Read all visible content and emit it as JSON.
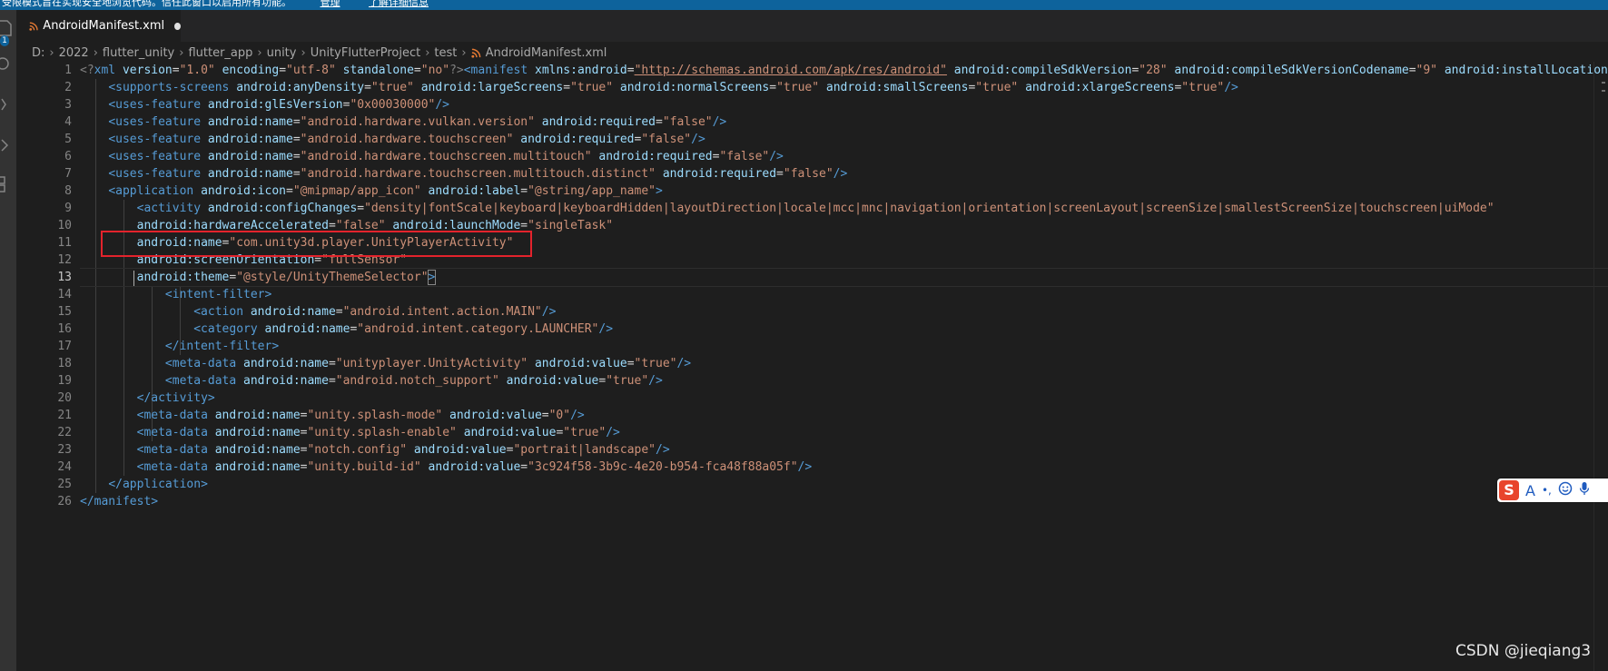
{
  "banner": {
    "text": "受限模式旨在实现安全地浏览代码。信任此窗口以启用所有功能。",
    "manage_link": "管理",
    "learn_more_link": "了解详细信息"
  },
  "activity_bar": {
    "badge_count": "1"
  },
  "tab": {
    "file_name": "AndroidManifest.xml",
    "modified": true
  },
  "breadcrumb": {
    "parts": [
      "D:",
      "2022",
      "flutter_unity",
      "flutter_app",
      "unity",
      "UnityFlutterProject",
      "test",
      "AndroidManifest.xml"
    ]
  },
  "editor": {
    "line_numbers": [
      "1",
      "2",
      "3",
      "4",
      "5",
      "6",
      "7",
      "8",
      "9",
      "10",
      "11",
      "12",
      "13",
      "14",
      "15",
      "16",
      "17",
      "18",
      "19",
      "20",
      "21",
      "22",
      "23",
      "24",
      "25",
      "26"
    ],
    "current_line": 13,
    "lines": {
      "l1": {
        "pi_open": "<?",
        "pi_name": "xml",
        "attr1": "version",
        "val1": "\"1.0\"",
        "attr2": "encoding",
        "val2": "\"utf-8\"",
        "attr3": "standalone",
        "val3": "\"no\"",
        "pi_close": "?>",
        "tag_open": "<manifest",
        "attr4": "xmlns:android",
        "val4": "\"http://schemas.android.com/apk/res/android\"",
        "attr5": "android:compileSdkVersion",
        "val5": "\"28\"",
        "attr6": "android:compileSdkVersionCodename",
        "val6": "\"9\"",
        "attr7": "android:installLocation",
        "val7": "\""
      },
      "l2": {
        "tag": "<supports-screens",
        "a1": "android:anyDensity",
        "v1": "\"true\"",
        "a2": "android:largeScreens",
        "v2": "\"true\"",
        "a3": "android:normalScreens",
        "v3": "\"true\"",
        "a4": "android:smallScreens",
        "v4": "\"true\"",
        "a5": "android:xlargeScreens",
        "v5": "\"true\"",
        "end": "/>"
      },
      "l3": {
        "tag": "<uses-feature",
        "a1": "android:glEsVersion",
        "v1": "\"0x00030000\"",
        "end": "/>"
      },
      "l4": {
        "tag": "<uses-feature",
        "a1": "android:name",
        "v1": "\"android.hardware.vulkan.version\"",
        "a2": "android:required",
        "v2": "\"false\"",
        "end": "/>"
      },
      "l5": {
        "tag": "<uses-feature",
        "a1": "android:name",
        "v1": "\"android.hardware.touchscreen\"",
        "a2": "android:required",
        "v2": "\"false\"",
        "end": "/>"
      },
      "l6": {
        "tag": "<uses-feature",
        "a1": "android:name",
        "v1": "\"android.hardware.touchscreen.multitouch\"",
        "a2": "android:required",
        "v2": "\"false\"",
        "end": "/>"
      },
      "l7": {
        "tag": "<uses-feature",
        "a1": "android:name",
        "v1": "\"android.hardware.touchscreen.multitouch.distinct\"",
        "a2": "android:required",
        "v2": "\"false\"",
        "end": "/>"
      },
      "l8": {
        "tag": "<application",
        "a1": "android:icon",
        "v1": "\"@mipmap/app_icon\"",
        "a2": "android:label",
        "v2": "\"@string/app_name\"",
        "end": ">"
      },
      "l9": {
        "tag": "<activity",
        "a1": "android:configChanges",
        "v1": "\"density|fontScale|keyboard|keyboardHidden|layoutDirection|locale|mcc|mnc|navigation|orientation|screenLayout|screenSize|smallestScreenSize|touchscreen|uiMode\""
      },
      "l10": {
        "a1": "android:hardwareAccelerated",
        "v1": "\"false\"",
        "a2": "android:launchMode",
        "v2": "\"singleTask\""
      },
      "l11": {
        "a1": "android:name",
        "v1": "\"com.unity3d.player.UnityPlayerActivity\""
      },
      "l12": {
        "a1": "android:screenOrientation",
        "v1": "\"fullSensor\""
      },
      "l13": {
        "a1": "android:theme",
        "v1": "\"@style/UnityThemeSelector\"",
        "end": ">"
      },
      "l14": {
        "tag": "<intent-filter",
        "end": ">"
      },
      "l15": {
        "tag": "<action",
        "a1": "android:name",
        "v1": "\"android.intent.action.MAIN\"",
        "end": "/>"
      },
      "l16": {
        "tag": "<category",
        "a1": "android:name",
        "v1": "\"android.intent.category.LAUNCHER\"",
        "end": "/>"
      },
      "l17": {
        "tag": "</intent-filter",
        "end": ">"
      },
      "l18": {
        "tag": "<meta-data",
        "a1": "android:name",
        "v1": "\"unityplayer.UnityActivity\"",
        "a2": "android:value",
        "v2": "\"true\"",
        "end": "/>"
      },
      "l19": {
        "tag": "<meta-data",
        "a1": "android:name",
        "v1": "\"android.notch_support\"",
        "a2": "android:value",
        "v2": "\"true\"",
        "end": "/>"
      },
      "l20": {
        "tag": "</activity",
        "end": ">"
      },
      "l21": {
        "tag": "<meta-data",
        "a1": "android:name",
        "v1": "\"unity.splash-mode\"",
        "a2": "android:value",
        "v2": "\"0\"",
        "end": "/>"
      },
      "l22": {
        "tag": "<meta-data",
        "a1": "android:name",
        "v1": "\"unity.splash-enable\"",
        "a2": "android:value",
        "v2": "\"true\"",
        "end": "/>"
      },
      "l23": {
        "tag": "<meta-data",
        "a1": "android:name",
        "v1": "\"notch.config\"",
        "a2": "android:value",
        "v2": "\"portrait|landscape\"",
        "end": "/>"
      },
      "l24": {
        "tag": "<meta-data",
        "a1": "android:name",
        "v1": "\"unity.build-id\"",
        "a2": "android:value",
        "v2": "\"3c924f58-3b9c-4e20-b954-fca48f88a05f\"",
        "end": "/>"
      },
      "l25": {
        "tag": "</application",
        "end": ">"
      },
      "l26": {
        "tag": "</manifest",
        "end": ">"
      }
    }
  },
  "ime_toolbar": {
    "logo": "S",
    "mode": "A",
    "punct": "•,"
  },
  "watermark": "CSDN @jieqiang3",
  "colors": {
    "tag": "#569cd6",
    "attribute": "#9cdcfe",
    "string": "#ce9178",
    "punctuation": "#808080",
    "highlight_box": "#e3232c",
    "banner": "#0e639c"
  }
}
